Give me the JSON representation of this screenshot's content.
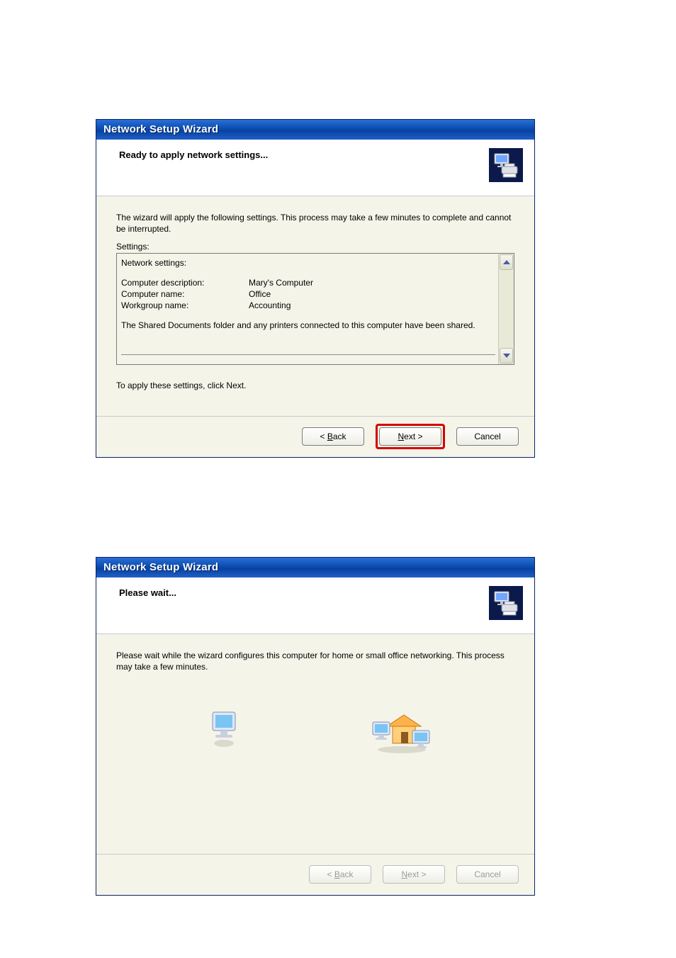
{
  "dialog1": {
    "title": "Network Setup Wizard",
    "heading": "Ready to apply network settings...",
    "intro": "The wizard will apply the following settings. This process may take a few minutes to complete and cannot be interrupted.",
    "settings_label": "Settings:",
    "box": {
      "section_title": "Network settings:",
      "rows": [
        {
          "k": "Computer description:",
          "v": "Mary's Computer"
        },
        {
          "k": "Computer name:",
          "v": "Office"
        },
        {
          "k": "Workgroup name:",
          "v": "Accounting"
        }
      ],
      "sharing_note": "The Shared Documents folder and any printers connected to this computer have been shared."
    },
    "apply_hint": "To apply these settings, click Next.",
    "buttons": {
      "back": "Back",
      "next": "Next >",
      "cancel": "Cancel",
      "back_prefix": "< "
    }
  },
  "dialog2": {
    "title": "Network Setup Wizard",
    "heading": "Please wait...",
    "intro": "Please wait while the wizard configures this computer for home or small office networking. This process may take a few minutes.",
    "buttons": {
      "back": "Back",
      "next": "Next >",
      "cancel": "Cancel",
      "back_prefix": "< "
    }
  }
}
